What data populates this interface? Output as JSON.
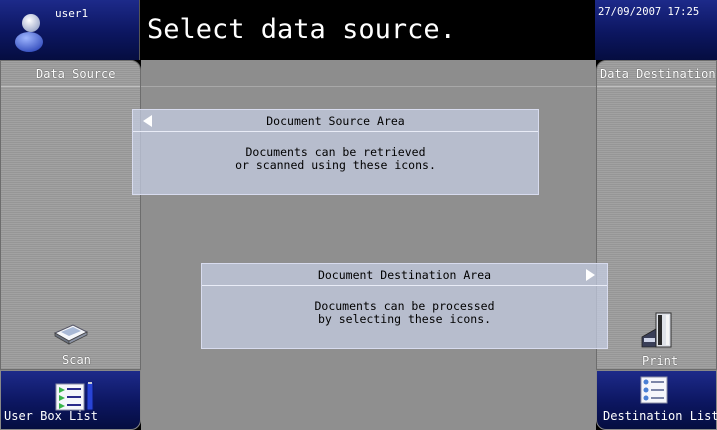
{
  "header": {
    "user_name": "user1",
    "title": "Select data source.",
    "datetime": "27/09/2007  17:25"
  },
  "left_panel": {
    "title": "Data Source",
    "scan_label": "Scan"
  },
  "right_panel": {
    "title": "Data Destination",
    "print_label": "Print"
  },
  "bottom": {
    "user_box_list_label": "User Box List",
    "destination_list_label": "Destination List"
  },
  "callouts": {
    "source": {
      "title": "Document Source Area",
      "line1": "Documents can be retrieved",
      "line2": "or scanned using these icons."
    },
    "destination": {
      "title": "Document Destination Area",
      "line1": "Documents can be processed",
      "line2": "by selecting these icons."
    }
  },
  "colors": {
    "header_blue": "#0c1660",
    "panel_gray": "#9c9c9c",
    "callout_fill": "#c6cee4"
  },
  "icons": {
    "user": "person-icon",
    "scan": "scanner-icon",
    "print": "printer-icon",
    "user_box": "list-with-usb-icon",
    "destination": "list-icon"
  }
}
